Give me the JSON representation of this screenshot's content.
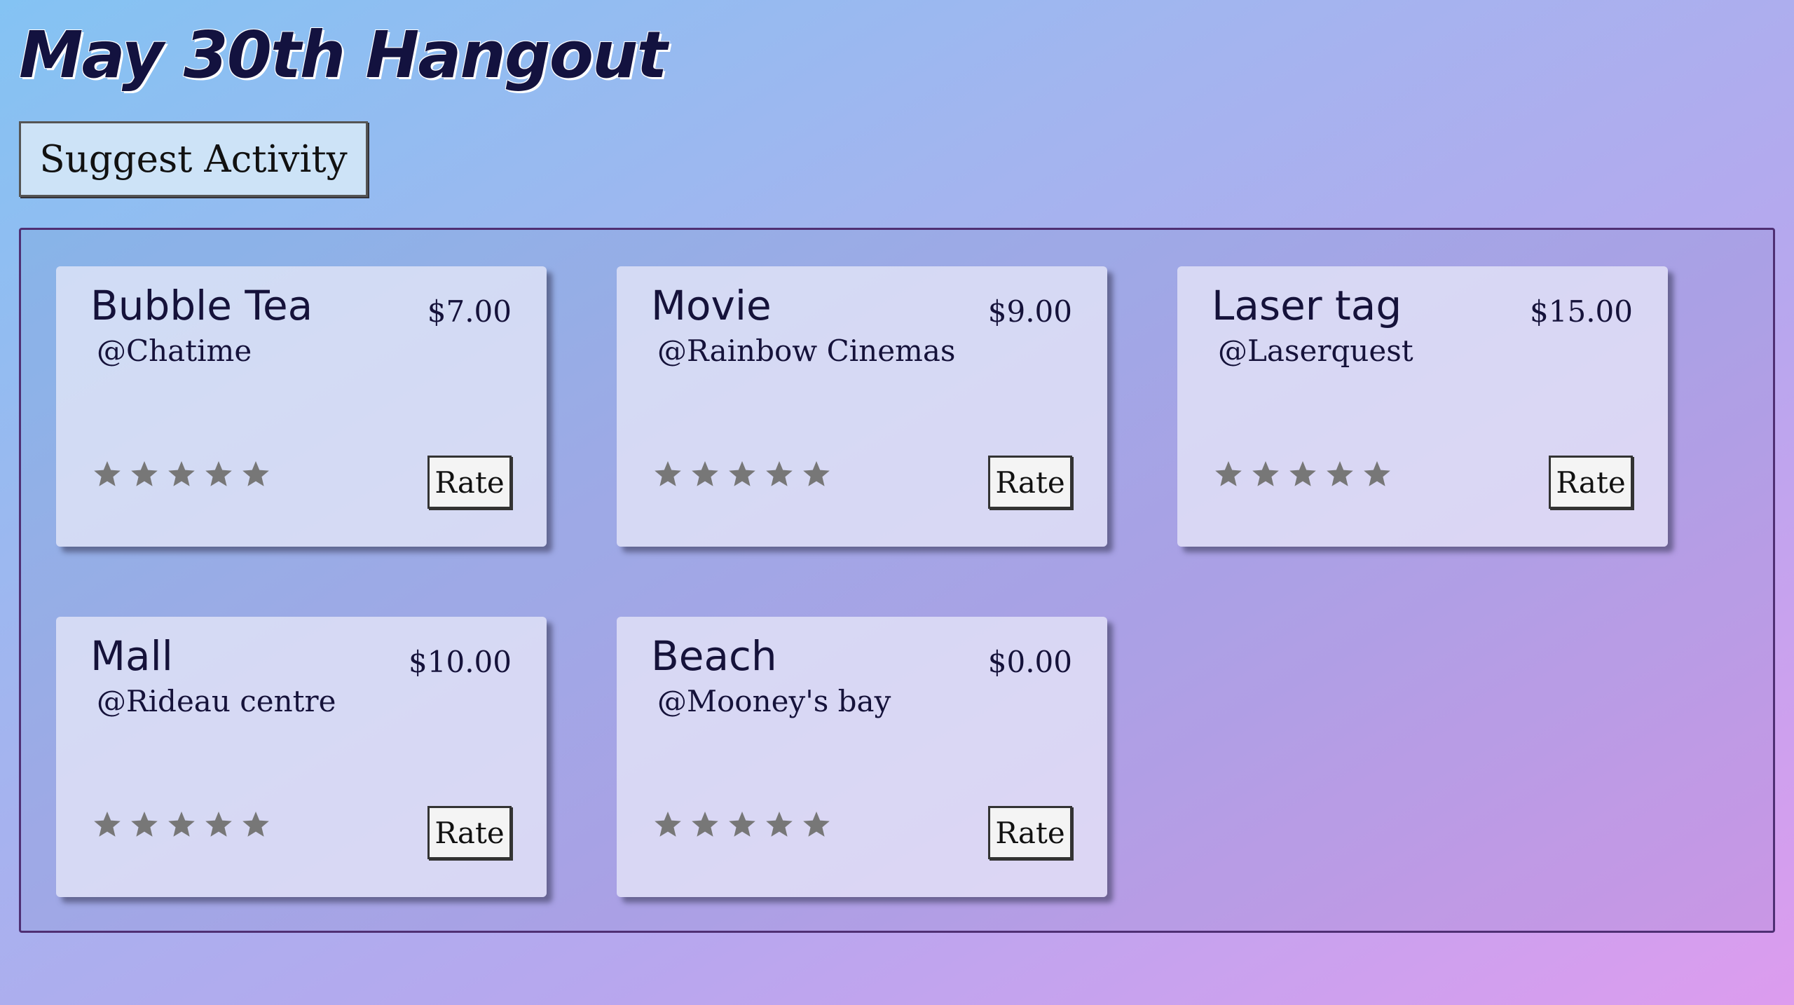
{
  "page": {
    "title": "May 30th Hangout",
    "suggest_label": "Suggest Activity"
  },
  "activities": [
    {
      "name": "Bubble Tea",
      "location": "@Chatime",
      "price": "$7.00",
      "rating": 0,
      "rate_label": "Rate"
    },
    {
      "name": "Movie",
      "location": "@Rainbow Cinemas",
      "price": "$9.00",
      "rating": 0,
      "rate_label": "Rate"
    },
    {
      "name": "Laser tag",
      "location": "@Laserquest",
      "price": "$15.00",
      "rating": 0,
      "rate_label": "Rate"
    },
    {
      "name": "Mall",
      "location": "@Rideau centre",
      "price": "$10.00",
      "rating": 0,
      "rate_label": "Rate"
    },
    {
      "name": "Beach",
      "location": "@Mooney's bay",
      "price": "$0.00",
      "rating": 0,
      "rate_label": "Rate"
    }
  ],
  "rating_max": 5,
  "colors": {
    "title": "#13123f",
    "star_empty": "#777777",
    "panel_border": "#4f2f73"
  },
  "icons": {
    "star": "star-icon"
  }
}
